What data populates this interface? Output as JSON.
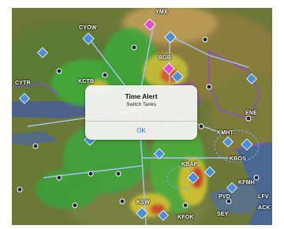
{
  "alert": {
    "title": "Time Alert",
    "message": "Switch Tanks",
    "ok_label": "OK"
  },
  "map": {
    "waypoints": [
      "YMX",
      "CYOW",
      "BGB",
      "ENE",
      "CYTR",
      "KCTB",
      "KBOS",
      "KMHT",
      "KBAF",
      "KFMH",
      "KSW",
      "KFOK",
      "LFV",
      "ACK",
      "PVD",
      "SEY"
    ],
    "colors": {
      "terrain_green": "#5f7a33",
      "terrain_olive": "#86773a",
      "weather_green": "#3fae3a",
      "weather_yellow": "#d8c830",
      "weather_red": "#d83a2a",
      "airspace_purple": "#8a4fd0",
      "airport_blue": "#4a8fd8",
      "route_blue": "#9ab8e8",
      "water": "#4f6890"
    }
  }
}
